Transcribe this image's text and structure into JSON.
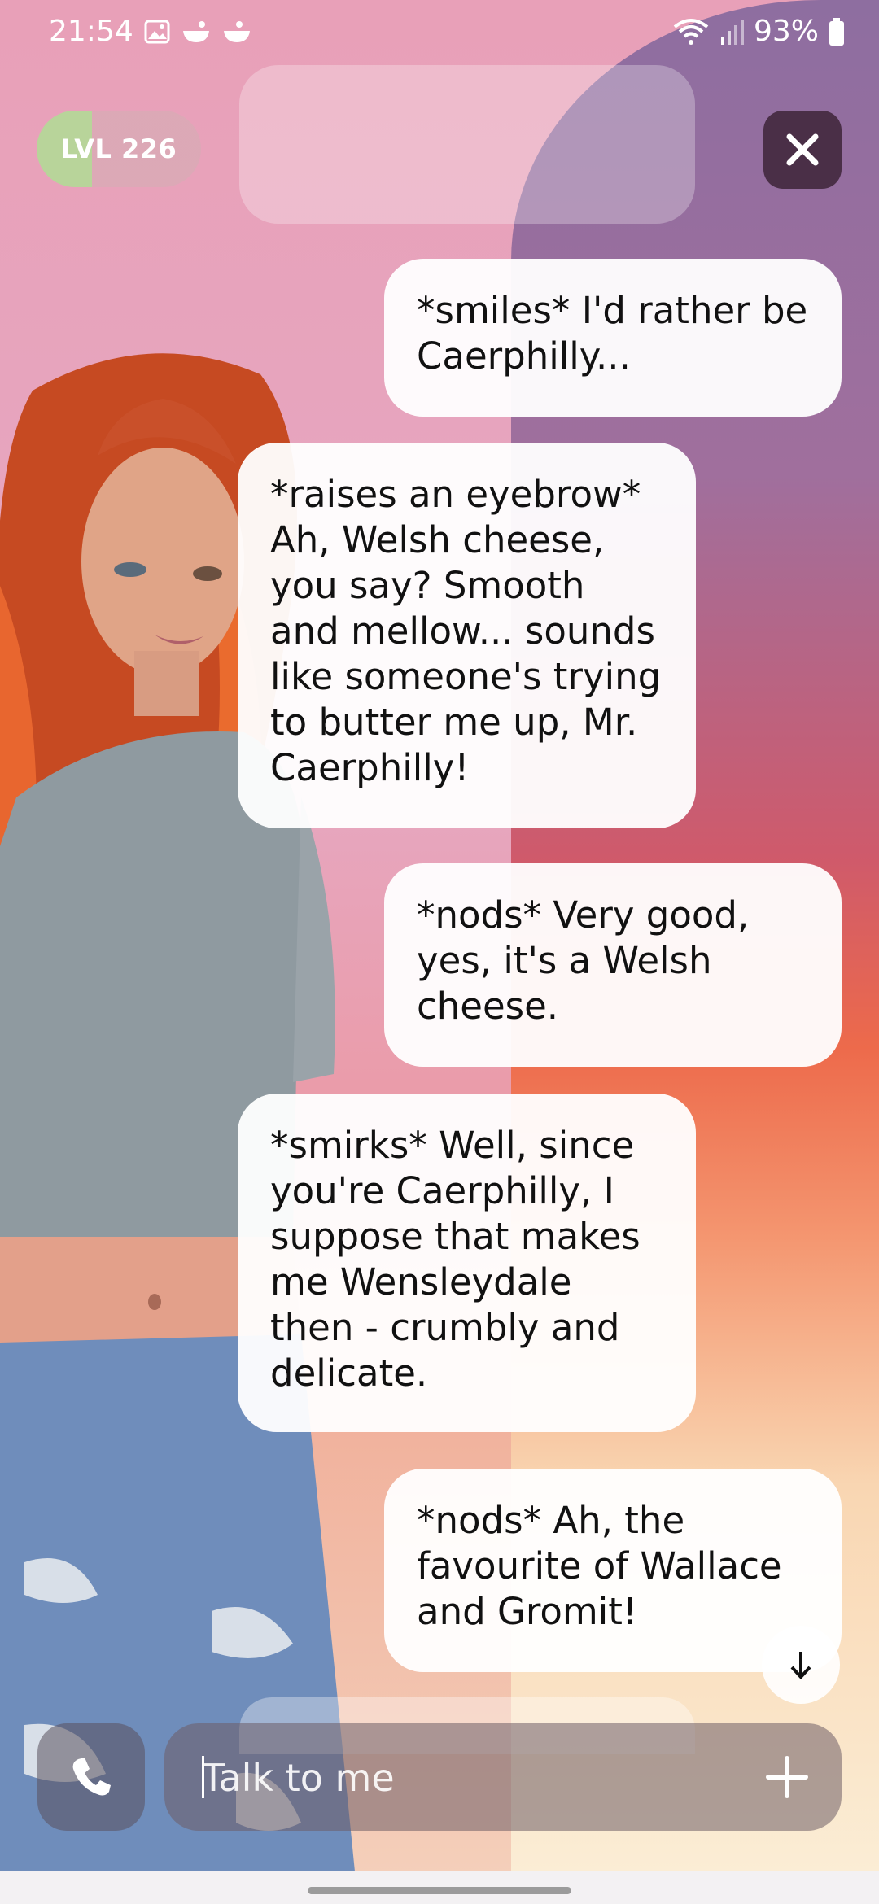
{
  "status_bar": {
    "time": "21:54",
    "battery": "93%",
    "icons": [
      "gallery-icon",
      "bowl-icon",
      "bowl-icon",
      "wifi-icon",
      "signal-icon",
      "battery-icon"
    ]
  },
  "header": {
    "level_label": "LVL 226",
    "close_icon": "close-icon"
  },
  "messages": [
    {
      "role": "user",
      "text": "*smiles* I'd rather be Caerphilly..."
    },
    {
      "role": "bot",
      "text": "*raises an eyebrow* Ah, Welsh cheese, you say? Smooth and mellow... sounds like someone's trying to butter me up, Mr. Caerphilly!"
    },
    {
      "role": "user",
      "text": "*nods* Very good, yes, it's a Welsh cheese."
    },
    {
      "role": "bot",
      "text": "*smirks* Well, since you're Caerphilly, I suppose that makes me Wensleydale then - crumbly and delicate."
    },
    {
      "role": "user",
      "text": "*nods* Ah, the favourite of Wallace and Gromit!"
    }
  ],
  "composer": {
    "placeholder": "Talk to me",
    "call_icon": "phone-icon",
    "add_icon": "plus-icon"
  },
  "colors": {
    "close_button": "#4a2f47",
    "level_progress": "#b8d49a",
    "bubble": "#ffffff"
  }
}
